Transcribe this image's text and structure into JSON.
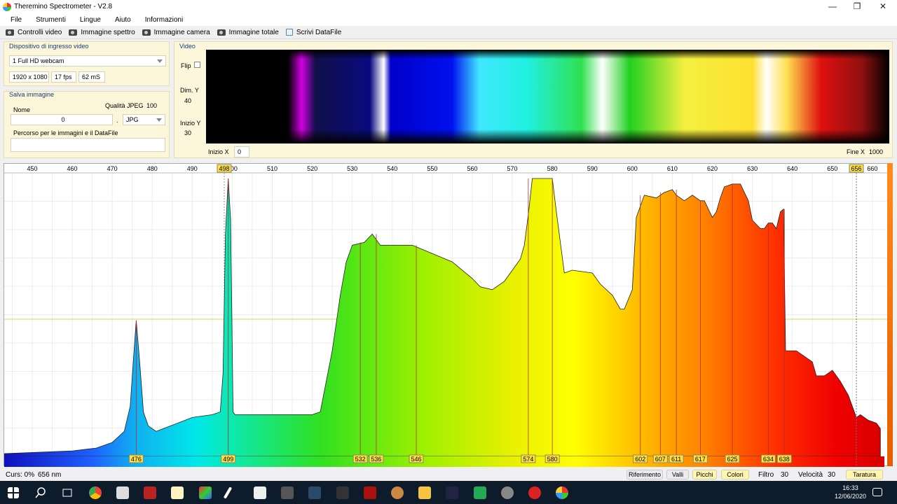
{
  "window": {
    "title": "Theremino Spectrometer - V2.8",
    "minimize": "—",
    "maximize": "❐",
    "close": "✕"
  },
  "menu": [
    "File",
    "Strumenti",
    "Lingue",
    "Aiuto",
    "Informazioni"
  ],
  "toolbar": {
    "controlli_video": "Controlli video",
    "immagine_spettro": "Immagine spettro",
    "immagine_camera": "Immagine camera",
    "immagine_totale": "Immagine totale",
    "scrivi_datafile": "Scrivi DataFile"
  },
  "device_panel": {
    "label": "Dispositivo di ingresso video",
    "device": "1 Full HD webcam",
    "resolution": "1920 x 1080",
    "fps": "17 fps",
    "ms": "62 mS"
  },
  "save_panel": {
    "label": "Salva immagine",
    "nome_label": "Nome",
    "nome_value": "0",
    "dot": ".",
    "qualita_label": "Qualità JPEG",
    "qualita_value": "100",
    "format": "JPG",
    "percorso_label": "Percorso per le immagini e il DataFile"
  },
  "video_panel": {
    "label": "Video",
    "flip": "Flip",
    "dim_y_label": "Dim. Y",
    "dim_y_value": "40",
    "inizio_y_label": "Inizio Y",
    "inizio_y_value": "30",
    "inizio_x_label": "Inizio X",
    "inizio_x_value": "0",
    "fine_x_label": "Fine X",
    "fine_x_value": "1000"
  },
  "chart_data": {
    "type": "area",
    "x_range": [
      443,
      663
    ],
    "y_range": [
      0,
      100
    ],
    "ticks": [
      450,
      460,
      470,
      480,
      490,
      500,
      510,
      520,
      530,
      540,
      550,
      560,
      570,
      580,
      590,
      600,
      610,
      620,
      630,
      640,
      650,
      660
    ],
    "cursor_marker": "498",
    "marker_656": "656",
    "peaks": [
      "476",
      "499",
      "532",
      "536",
      "546",
      "574",
      "580",
      "602",
      "607",
      "611",
      "617",
      "625",
      "634",
      "638"
    ],
    "peak_values": [
      476,
      499,
      532,
      536,
      546,
      574,
      580,
      602,
      607,
      611,
      617,
      625,
      634,
      638
    ],
    "x": [
      443,
      460,
      466,
      470,
      473,
      474.5,
      475.3,
      476,
      476.8,
      477.8,
      479,
      481,
      490,
      495,
      497,
      497.7,
      498.3,
      499,
      499.6,
      500.2,
      500.7,
      501,
      520,
      522,
      525,
      527,
      528.5,
      530,
      533,
      535,
      537,
      540,
      545,
      550,
      555,
      560,
      562,
      565,
      568,
      570,
      572,
      573,
      574,
      575,
      580,
      581,
      583,
      585,
      590,
      592,
      595,
      597,
      598,
      600,
      601,
      603,
      606,
      608,
      610,
      611,
      613,
      615,
      617,
      618,
      620,
      621,
      622,
      623,
      625,
      627,
      629,
      630,
      632,
      633,
      634,
      635,
      636,
      637,
      637.8,
      638.3,
      641,
      643,
      645,
      646,
      648,
      650,
      652,
      654,
      656,
      657,
      659,
      661,
      662
    ],
    "y": [
      1,
      2,
      3,
      5,
      9,
      18,
      35,
      49,
      35,
      16,
      11,
      9,
      14,
      15,
      16,
      30,
      80,
      100,
      85,
      16,
      15,
      15,
      15,
      16,
      38,
      58,
      70,
      76,
      77,
      80,
      76,
      76,
      76,
      73,
      70,
      64,
      61,
      60,
      63,
      67,
      71,
      76,
      87,
      100,
      100,
      88,
      66,
      67,
      66,
      62,
      58,
      53,
      53,
      60,
      86,
      94,
      93,
      95,
      96,
      94,
      92,
      94,
      92,
      92,
      86,
      88,
      93,
      97,
      98,
      98,
      92,
      85,
      82,
      82,
      84,
      84,
      82,
      88,
      89,
      38,
      38,
      36,
      34,
      29,
      29,
      31,
      27,
      22,
      14,
      15,
      13,
      12,
      10,
      8
    ]
  },
  "status": {
    "curs": "Curs: 0%",
    "nm": "656 nm",
    "riferimento": "Riferimento",
    "valli": "Valli",
    "picchi": "Picchi",
    "colori": "Colori",
    "filtro_label": "Filtro",
    "filtro_value": "30",
    "velocita_label": "Velocità",
    "velocita_value": "30",
    "taratura": "Taratura"
  },
  "taskbar": {
    "time": "16:33",
    "date": "12/06/2020"
  }
}
